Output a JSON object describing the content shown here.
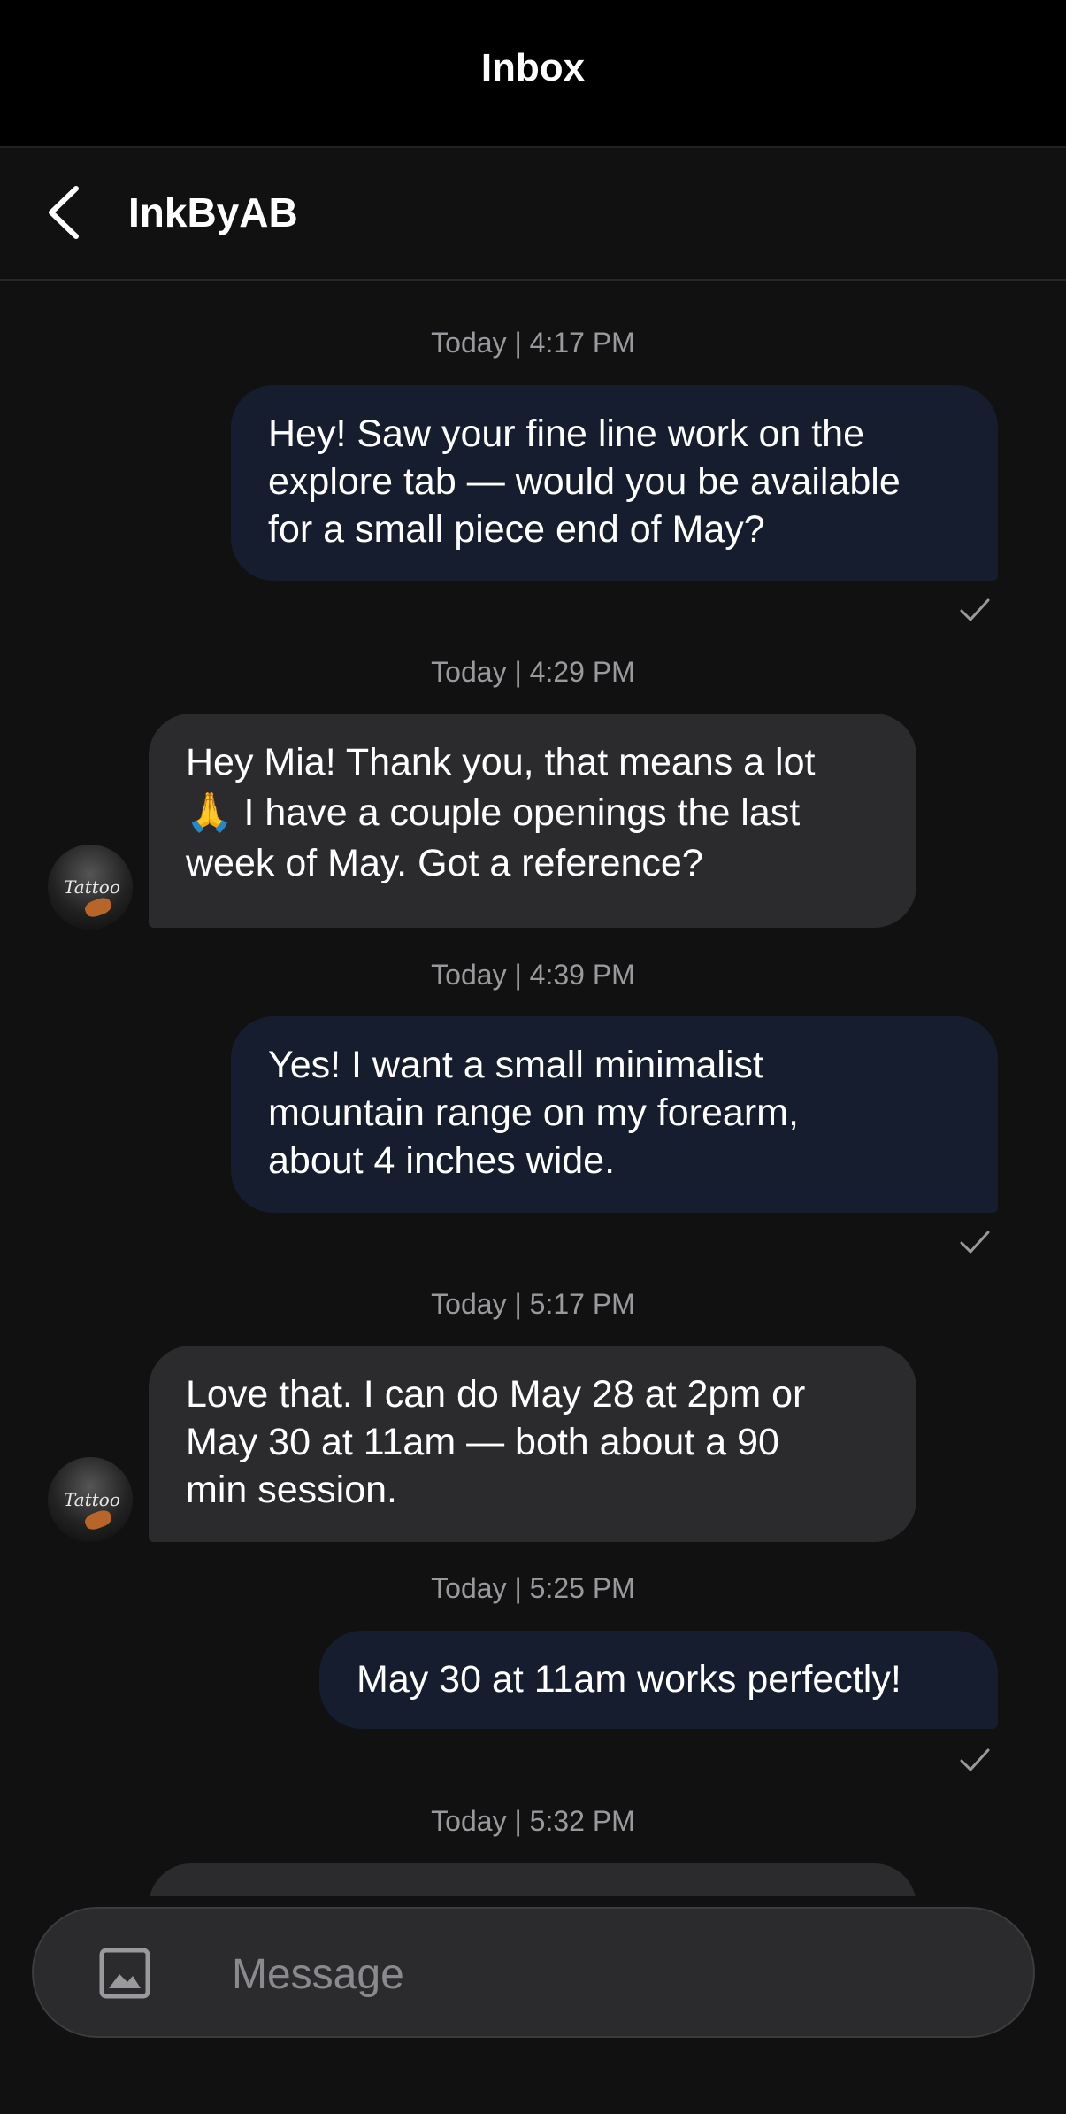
{
  "header": {
    "title": "Inbox"
  },
  "chat": {
    "contact_name": "InkByAB",
    "avatar_text": "Tattoo"
  },
  "messages": [
    {
      "timestamp": "Today | 4:17 PM",
      "direction": "sent",
      "lines": [
        "Hey! Saw your fine line work on the",
        "explore tab — would you be available",
        "for a small piece end of May?"
      ],
      "read": true
    },
    {
      "timestamp": "Today | 4:29 PM",
      "direction": "received",
      "lines": [
        "Hey Mia! Thank you, that means a lot",
        "🙏 I have a couple openings the last",
        "week of May. Got a reference?"
      ]
    },
    {
      "timestamp": "Today | 4:39 PM",
      "direction": "sent",
      "lines": [
        "Yes! I want a small minimalist",
        "mountain range on my forearm,",
        "about 4 inches wide."
      ],
      "read": true
    },
    {
      "timestamp": "Today | 5:17 PM",
      "direction": "received",
      "lines": [
        "Love that. I can do May 28 at 2pm or",
        "May 30 at 11am — both about a 90",
        "min session."
      ]
    },
    {
      "timestamp": "Today | 5:25 PM",
      "direction": "sent",
      "lines": [
        "May 30 at 11am works perfectly!"
      ],
      "read": true
    },
    {
      "timestamp": "Today | 5:32 PM",
      "direction": "received",
      "lines": [
        ""
      ]
    }
  ],
  "composer": {
    "placeholder": "Message"
  },
  "colors": {
    "background": "#111112",
    "sent_bubble": "#161d2e",
    "received_bubble": "#2b2b2d",
    "timestamp": "#9a9a9e"
  }
}
